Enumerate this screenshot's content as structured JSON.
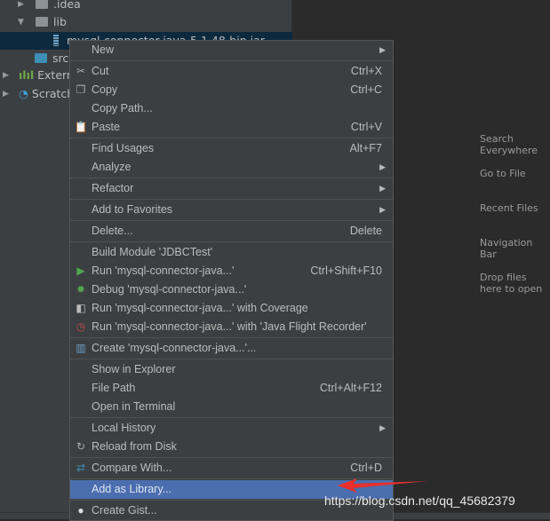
{
  "project_tree": {
    "items": [
      {
        "label": ".idea",
        "type": "folder"
      },
      {
        "label": "lib",
        "type": "folder"
      },
      {
        "label": "mysql-connector-java-5.1.48-bin.jar",
        "type": "jar",
        "selected": true
      },
      {
        "label": "src",
        "type": "folder"
      },
      {
        "label": "External Libraries",
        "type": "libraries"
      },
      {
        "label": "Scratches and Consoles",
        "type": "scratches"
      }
    ]
  },
  "welcome": [
    "Search Everywhere",
    "Go to File",
    "Recent Files",
    "Navigation Bar",
    "Drop files here to open"
  ],
  "menu": {
    "highlight_color": "#4b6eaf",
    "items": [
      {
        "label": "New",
        "submenu": true
      },
      {
        "label": "Cut",
        "shortcut": "Ctrl+X",
        "icon": "scissors-icon"
      },
      {
        "label": "Copy",
        "shortcut": "Ctrl+C",
        "icon": "copy-icon"
      },
      {
        "label": "Copy Path..."
      },
      {
        "label": "Paste",
        "shortcut": "Ctrl+V",
        "icon": "clipboard-icon"
      },
      {
        "label": "Find Usages",
        "shortcut": "Alt+F7"
      },
      {
        "label": "Analyze",
        "submenu": true
      },
      {
        "label": "Refactor",
        "submenu": true
      },
      {
        "label": "Add to Favorites",
        "submenu": true
      },
      {
        "label": "Delete...",
        "shortcut": "Delete"
      },
      {
        "label": "Build Module 'JDBCTest'"
      },
      {
        "label": "Run 'mysql-connector-java...'",
        "shortcut": "Ctrl+Shift+F10",
        "icon": "run-icon"
      },
      {
        "label": "Debug 'mysql-connector-java...'",
        "icon": "bug-icon"
      },
      {
        "label": "Run 'mysql-connector-java...' with Coverage",
        "icon": "coverage-icon"
      },
      {
        "label": "Run 'mysql-connector-java...' with 'Java Flight Recorder'",
        "icon": "profiler-icon"
      },
      {
        "label": "Create 'mysql-connector-java...'...",
        "icon": "jar-icon"
      },
      {
        "label": "Show in Explorer"
      },
      {
        "label": "File Path",
        "shortcut": "Ctrl+Alt+F12"
      },
      {
        "label": "Open in Terminal"
      },
      {
        "label": "Local History",
        "submenu": true
      },
      {
        "label": "Reload from Disk",
        "icon": "reload-icon"
      },
      {
        "label": "Compare With...",
        "shortcut": "Ctrl+D",
        "icon": "compare-icon"
      },
      {
        "label": "Add as Library...",
        "highlighted": true
      },
      {
        "label": "Create Gist...",
        "icon": "github-icon"
      }
    ]
  },
  "watermark": "https://blog.csdn.net/qq_45682379"
}
